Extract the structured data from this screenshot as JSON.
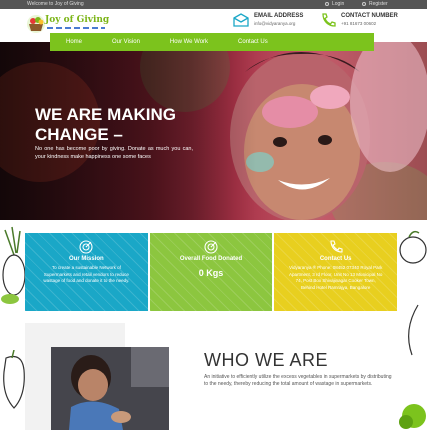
{
  "topbar": {
    "welcome": "Welcome to Joy of Giving",
    "login": "Login",
    "register": "Register"
  },
  "header": {
    "logo_text": "Joy of Giving",
    "email_label": "EMAIL ADDRESS",
    "email_value": "info@vidyaranya.org",
    "phone_label": "CONTACT NUMBER",
    "phone_value": "+91 81673 00602"
  },
  "nav": {
    "items": [
      {
        "label": "Home"
      },
      {
        "label": "Our Vision"
      },
      {
        "label": "How We Work"
      },
      {
        "label": "Contact Us"
      }
    ]
  },
  "hero": {
    "title": "WE ARE MAKING CHANGE –",
    "text": "No one has become poor by giving. Donate as much you can, your kindness make happiness one some faces"
  },
  "cards": [
    {
      "title": "Our Mission",
      "body": "To create a sustainable Network of Supermarkets and retail vendors to reduce wastage of food and donate it to the needy.",
      "color": "#1aa7c7",
      "icon": "target-icon"
    },
    {
      "title": "Overall Food Donated",
      "value": "0 Kgs",
      "color": "#8cc63f",
      "icon": "target-icon"
    },
    {
      "title": "Contact Us",
      "body": "Vidyaranya ® Phone: 08452 07340 Royal Park Apartment, 3 rd Floor, Unit No 13 Municipal No 74, Post Box Shivajinagar Cooker Town, Behind Hotel Ramrajya, Bangalore",
      "color": "#e8cf1f",
      "icon": "phone-icon"
    }
  ],
  "about": {
    "title": "WHO WE ARE",
    "text": "An initiative to efficiently utilize the excess vegetables in supermarkets by distributing to the needy, thereby reducing the total amount of wastage in supermarkets."
  },
  "colors": {
    "brand_green": "#7cc31d",
    "topbar": "#555555"
  }
}
